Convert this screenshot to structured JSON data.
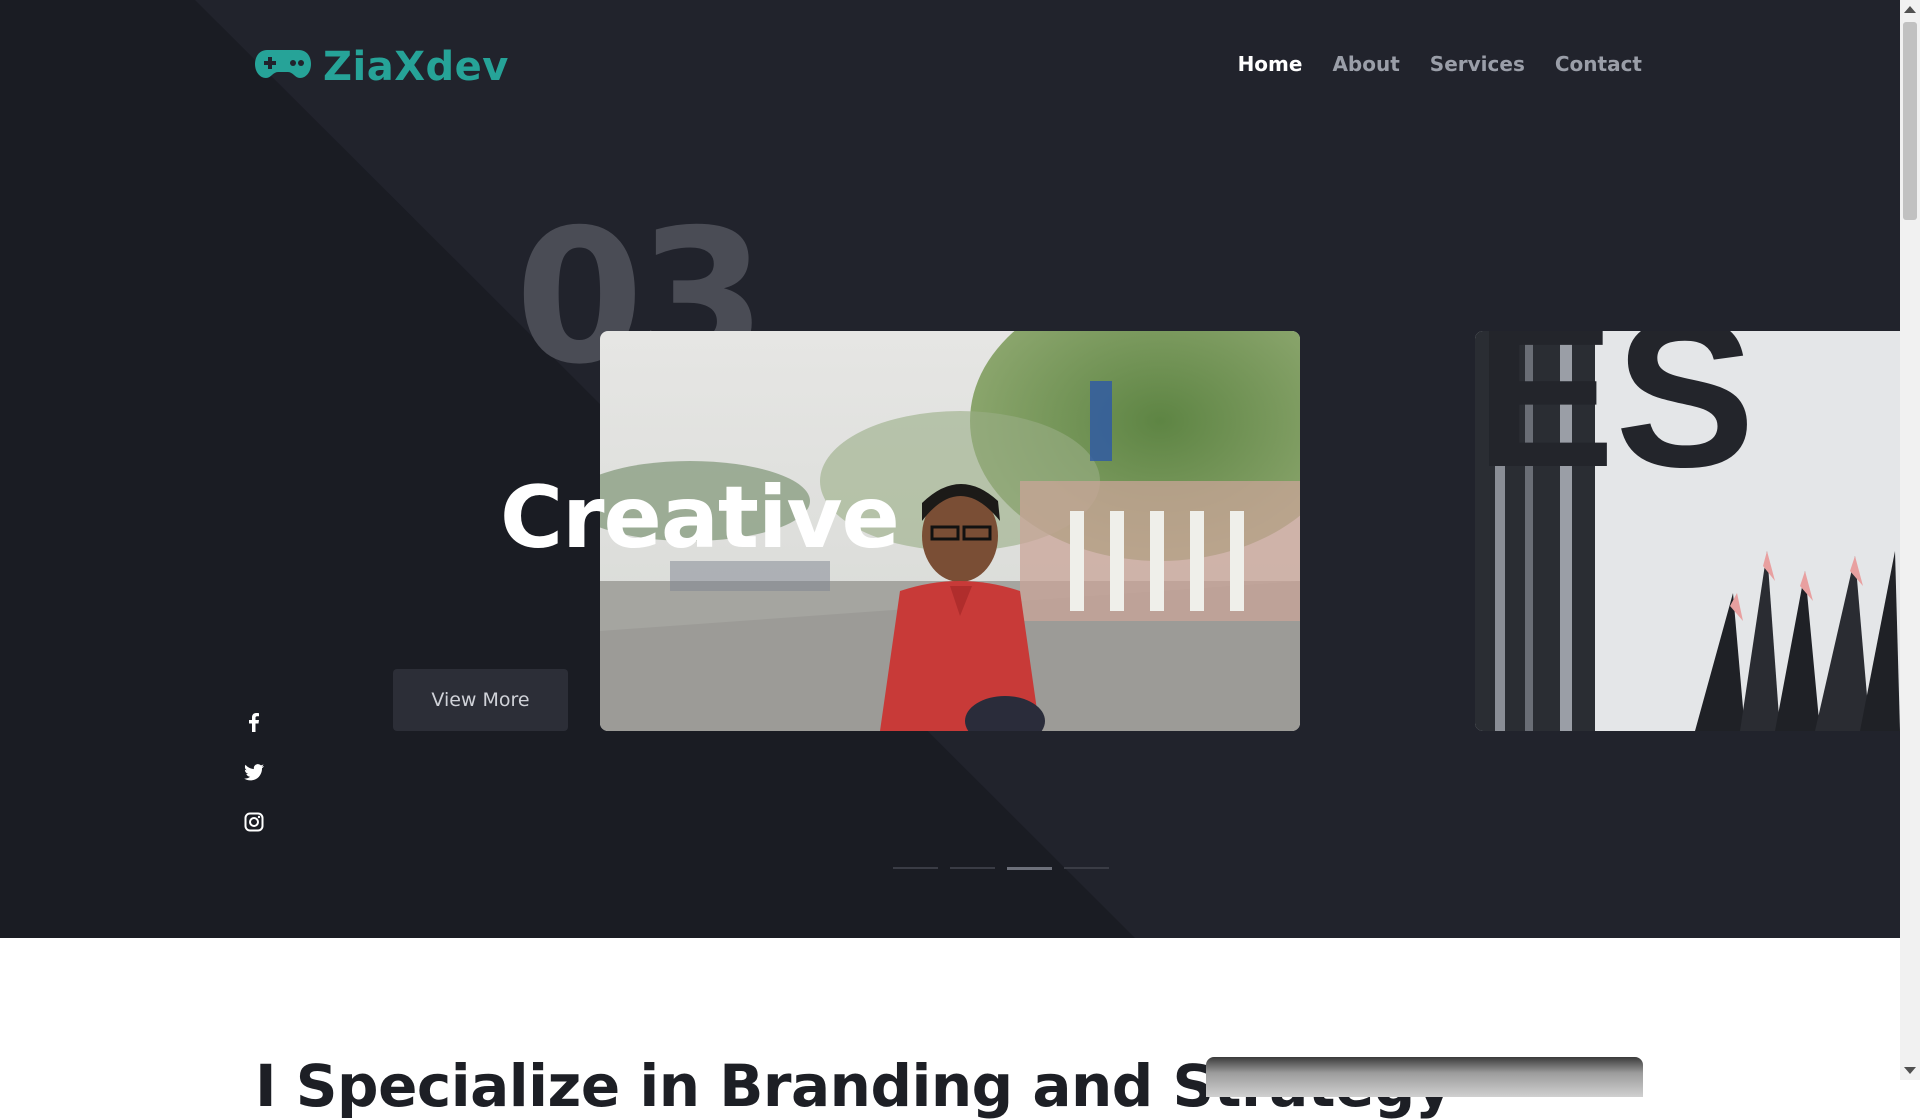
{
  "brand": {
    "name": "ZiaXdev",
    "logo_icon": "gamepad-icon",
    "accent": "#26a398"
  },
  "nav": {
    "items": [
      {
        "label": "Home",
        "active": true
      },
      {
        "label": "About",
        "active": false
      },
      {
        "label": "Services",
        "active": false
      },
      {
        "label": "Contact",
        "active": false
      }
    ]
  },
  "hero": {
    "slide_number": "03",
    "headline": "Creative",
    "cta_label": "View More",
    "background": "#21232c",
    "slides_total": 4,
    "active_slide": 3
  },
  "social": {
    "icons": [
      "facebook-icon",
      "twitter-icon",
      "instagram-icon"
    ]
  },
  "section": {
    "title": "I Specialize in Branding and Strategy"
  }
}
